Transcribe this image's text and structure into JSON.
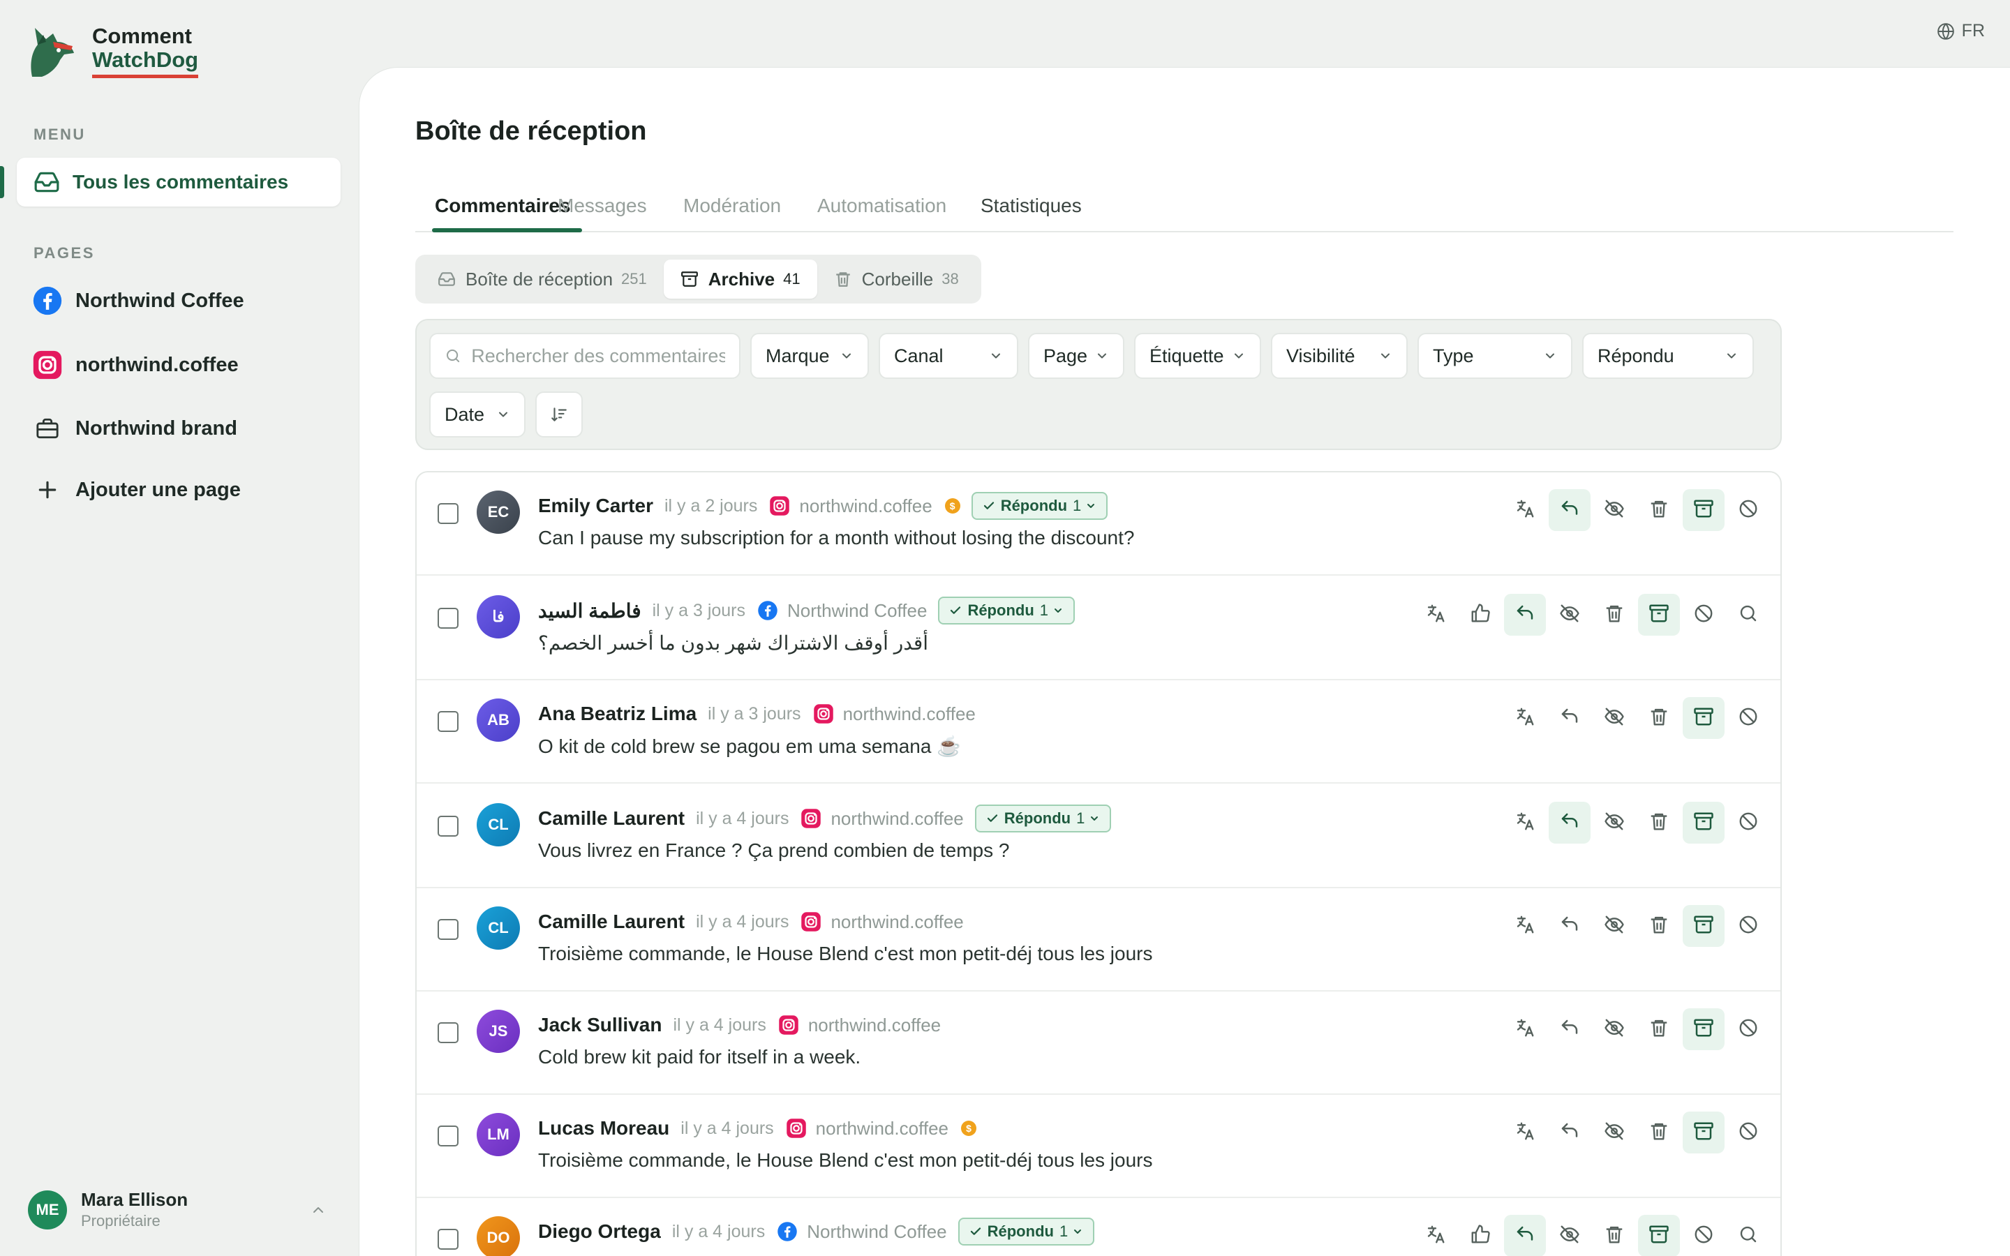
{
  "brand": {
    "line1": "Comment",
    "line2": "WatchDog"
  },
  "sidebar": {
    "menu_label": "MENU",
    "menu_item": "Tous les commentaires",
    "pages_label": "PAGES",
    "pages": [
      {
        "label": "Northwind Coffee",
        "icon": "facebook-icon"
      },
      {
        "label": "northwind.coffee",
        "icon": "instagram-icon"
      },
      {
        "label": "Northwind brand",
        "icon": "briefcase-icon"
      },
      {
        "label": "Ajouter une page",
        "icon": "plus-icon"
      }
    ],
    "user": {
      "initials": "ME",
      "name": "Mara Ellison",
      "role": "Propriétaire"
    }
  },
  "lang": "FR",
  "main": {
    "title": "Boîte de réception",
    "tabs": [
      "Commentaires",
      "Messages",
      "Modération",
      "Automatisation",
      "Statistiques"
    ],
    "segments": [
      {
        "label": "Boîte de réception",
        "count": "251"
      },
      {
        "label": "Archive",
        "count": "41"
      },
      {
        "label": "Corbeille",
        "count": "38"
      }
    ],
    "search_placeholder": "Rechercher des commentaires...",
    "filters": [
      "Marque",
      "Canal",
      "Page",
      "Étiquette",
      "Visibilité",
      "Type",
      "Répondu",
      "Date"
    ]
  },
  "comments": [
    {
      "initials": "EC",
      "name": "Emily Carter",
      "time": "il y a 2 jours",
      "source": "northwind.coffee",
      "channel": "instagram",
      "coin": true,
      "badge": "Répondu",
      "badge_count": "1",
      "text": "Can I pause my subscription for a month without losing the discount?"
    },
    {
      "initials": "فا",
      "name": "فاطمة السيد",
      "time": "il y a 3 jours",
      "source": "Northwind Coffee",
      "channel": "facebook",
      "coin": false,
      "badge": "Répondu",
      "badge_count": "1",
      "text": "أقدر أوقف الاشتراك شهر بدون ما أخسر الخصم؟"
    },
    {
      "initials": "AB",
      "name": "Ana Beatriz Lima",
      "time": "il y a 3 jours",
      "source": "northwind.coffee",
      "channel": "instagram",
      "coin": false,
      "badge": null,
      "text": "O kit de cold brew se pagou em uma semana ☕"
    },
    {
      "initials": "CL",
      "name": "Camille Laurent",
      "time": "il y a 4 jours",
      "source": "northwind.coffee",
      "channel": "instagram",
      "coin": false,
      "badge": "Répondu",
      "badge_count": "1",
      "text": "Vous livrez en France ? Ça prend combien de temps ?"
    },
    {
      "initials": "CL",
      "name": "Camille Laurent",
      "time": "il y a 4 jours",
      "source": "northwind.coffee",
      "channel": "instagram",
      "coin": false,
      "badge": null,
      "text": "Troisième commande, le House Blend c'est mon petit-déj tous les jours"
    },
    {
      "initials": "JS",
      "name": "Jack Sullivan",
      "time": "il y a 4 jours",
      "source": "northwind.coffee",
      "channel": "instagram",
      "coin": false,
      "badge": null,
      "text": "Cold brew kit paid for itself in a week."
    },
    {
      "initials": "LM",
      "name": "Lucas Moreau",
      "time": "il y a 4 jours",
      "source": "northwind.coffee",
      "channel": "instagram",
      "coin": true,
      "badge": null,
      "text": "Troisième commande, le House Blend c'est mon petit-déj tous les jours"
    },
    {
      "initials": "DO",
      "name": "Diego Ortega",
      "time": "il y a 4 jours",
      "source": "Northwind Coffee",
      "channel": "facebook",
      "coin": false,
      "badge": "Répondu",
      "badge_count": "1",
      "text": ""
    }
  ],
  "colors": {
    "accent": "#1e6b48",
    "badge_bg": "#e9f6ee",
    "instagram": "#e4195f",
    "facebook": "#1877f2",
    "coin": "#f0a21c"
  }
}
